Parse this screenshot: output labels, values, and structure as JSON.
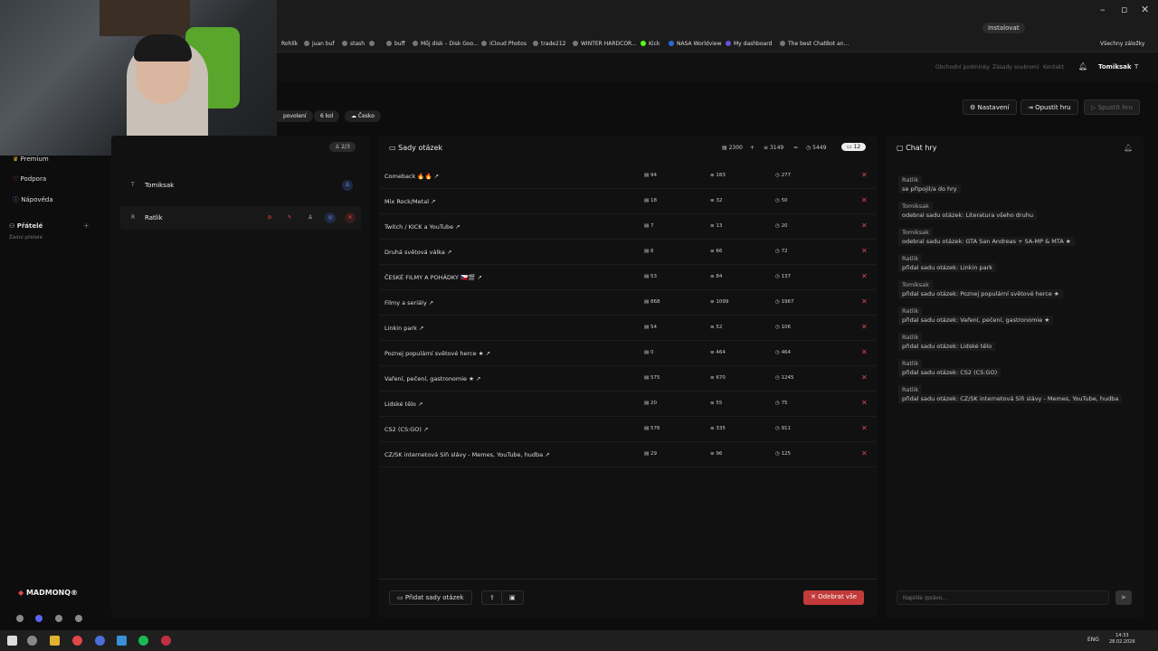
{
  "browser": {
    "install_label": "Instalovat",
    "all_bookmarks": "Všechny záložky",
    "bookmarks": [
      "Rohlík",
      "juan buf",
      "stash",
      "buff",
      "Můj disk – Disk Goo...",
      "iCloud Photos",
      "trade212",
      "WINTER HARDCOR...",
      "Kick",
      "NASA Worldview",
      "My dashboard",
      "The best ChatBot an..."
    ]
  },
  "topnav": {
    "links": [
      "Obchodní podmínky",
      "Zásady soukromí",
      "Kontakt"
    ],
    "user": "Tomiksak",
    "avatar_initial": "T"
  },
  "lobby": {
    "pills": [
      "povolení",
      "6 kol",
      "Česko"
    ],
    "settings": "Nastavení",
    "leave": "Opustit hru",
    "start": "Spustit hru"
  },
  "leftnav": {
    "premium": "Premium",
    "support": "Podpora",
    "help": "Nápověda",
    "friends": "Přátelé",
    "no_friends": "Žádní přátelé",
    "brand": "MADMONQ®"
  },
  "players": {
    "count": "2/3",
    "list": [
      {
        "initial": "T",
        "name": "Tomiksak"
      },
      {
        "initial": "R",
        "name": "Ratlik"
      }
    ]
  },
  "sets": {
    "title": "Sady otázek",
    "totals": {
      "a": "2300",
      "plus": "+",
      "b": "3149",
      "eq": "=",
      "c": "5449",
      "count": "12"
    },
    "rows": [
      {
        "name": "Comeback 🔥🔥",
        "a": "94",
        "b": "183",
        "c": "277"
      },
      {
        "name": "Mix Rock/Metal",
        "a": "18",
        "b": "32",
        "c": "50"
      },
      {
        "name": "Twitch / KICK a YouTube",
        "a": "7",
        "b": "13",
        "c": "20"
      },
      {
        "name": "Druhá světová válka",
        "a": "6",
        "b": "66",
        "c": "72"
      },
      {
        "name": "ČESKÉ FILMY A POHÁDKY 🇨🇿🎬",
        "a": "53",
        "b": "84",
        "c": "137"
      },
      {
        "name": "Filmy a seriály",
        "a": "868",
        "b": "1099",
        "c": "1967"
      },
      {
        "name": "Linkin park",
        "a": "54",
        "b": "52",
        "c": "106"
      },
      {
        "name": "Poznej populární světové herce ★",
        "a": "0",
        "b": "464",
        "c": "464"
      },
      {
        "name": "Vaření, pečení, gastronomie ★",
        "a": "575",
        "b": "670",
        "c": "1245"
      },
      {
        "name": "Lidské tělo",
        "a": "20",
        "b": "55",
        "c": "75"
      },
      {
        "name": "CS2 (CS:GO)",
        "a": "576",
        "b": "335",
        "c": "911"
      },
      {
        "name": "CZ/SK internetová Síň slávy - Memes, YouTube, hudba",
        "a": "29",
        "b": "96",
        "c": "125"
      }
    ],
    "add_button": "Přidat sady otázek",
    "remove_all": "Odebrat vše"
  },
  "chat": {
    "title": "Chat hry",
    "messages": [
      {
        "author": "Ratlik",
        "text": "se připojil/a do hry"
      },
      {
        "author": "Tomiksak",
        "text": "odebral sadu otázek: Literatura všeho druhu"
      },
      {
        "author": "Tomiksak",
        "text": "odebral sadu otázek: GTA San Andreas + SA-MP & MTA ★"
      },
      {
        "author": "Ratlik",
        "text": "přidal sadu otázek: Linkin park"
      },
      {
        "author": "Tomiksak",
        "text": "přidal sadu otázek: Poznej populární světové herce ★"
      },
      {
        "author": "Ratlik",
        "text": "přidal sadu otázek: Vaření, pečení, gastronomie ★"
      },
      {
        "author": "Ratlik",
        "text": "přidal sadu otázek: Lidské tělo"
      },
      {
        "author": "Ratlik",
        "text": "přidal sadu otázek: CS2 (CS:GO)"
      },
      {
        "author": "Ratlik",
        "text": "přidal sadu otázek: CZ/SK internetová Síň slávy - Memes, YouTube, hudba"
      }
    ],
    "placeholder": "Napište zprávu..."
  },
  "taskbar": {
    "lang": "ENG",
    "time": "14:33",
    "date": "28.02.2026"
  }
}
